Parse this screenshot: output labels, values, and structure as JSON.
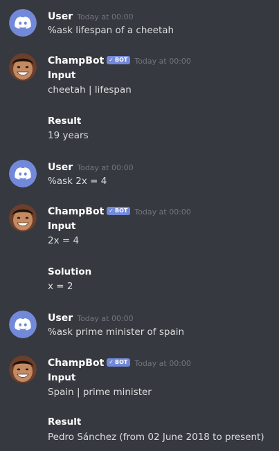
{
  "messages": [
    {
      "author": "User",
      "avatar_icon": "discord-logo-icon",
      "timestamp": "Today at 00:00",
      "text": "%ask lifespan of a cheetah"
    },
    {
      "author": "ChampBot",
      "avatar_icon": "champbot-face-avatar",
      "bot_tag": "BOT",
      "timestamp": "Today at 00:00",
      "section1_label": "Input",
      "section1_value": "cheetah | lifespan",
      "section2_label": "Result",
      "section2_value": "19 years"
    },
    {
      "author": "User",
      "avatar_icon": "discord-logo-icon",
      "timestamp": "Today at 00:00",
      "text": "%ask 2x = 4"
    },
    {
      "author": "ChampBot",
      "avatar_icon": "champbot-face-avatar",
      "bot_tag": "BOT",
      "timestamp": "Today at 00:00",
      "section1_label": "Input",
      "section1_value": "2x = 4",
      "section2_label": "Solution",
      "section2_value": "x = 2"
    },
    {
      "author": "User",
      "avatar_icon": "discord-logo-icon",
      "timestamp": "Today at 00:00",
      "text": "%ask prime minister of spain"
    },
    {
      "author": "ChampBot",
      "avatar_icon": "champbot-face-avatar",
      "bot_tag": "BOT",
      "timestamp": "Today at 00:00",
      "section1_label": "Input",
      "section1_value": "Spain | prime minister",
      "section2_label": "Result",
      "section2_value": "Pedro Sánchez (from 02 June 2018 to present)"
    }
  ],
  "colors": {
    "background": "#36393f",
    "discord_blurple": "#7289da",
    "username": "#ffffff",
    "timestamp": "#72767d",
    "text": "#dcddde"
  }
}
